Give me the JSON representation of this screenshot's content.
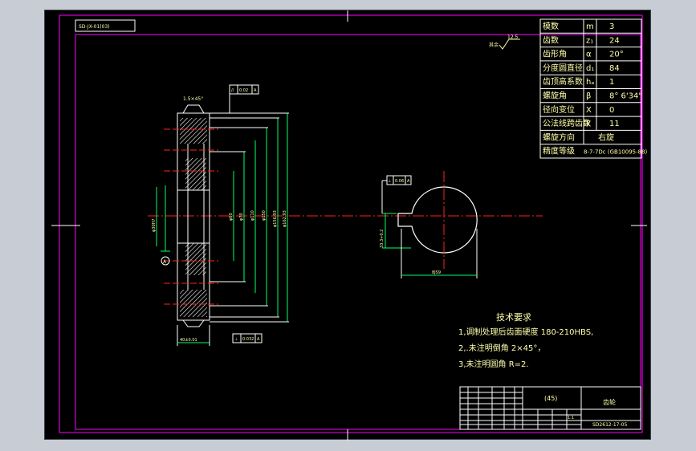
{
  "colors": {
    "background": "#000000",
    "frame": "#ff00ff",
    "line": "#ffffff",
    "text": "#ffffaa",
    "dimension": "#00ff66",
    "center": "#ff2020",
    "hatch": "#ffffff"
  },
  "drawing_code_box": "SD-JX-01(03)",
  "surface_finish": {
    "label": "其余",
    "value": "12.5"
  },
  "params_table": [
    {
      "name": "模数",
      "symbol": "m",
      "value": "3"
    },
    {
      "name": "齿数",
      "symbol": "z₁",
      "value": "24"
    },
    {
      "name": "齿形角",
      "symbol": "α",
      "value": "20°"
    },
    {
      "name": "分度圆直径",
      "symbol": "d₁",
      "value": "84"
    },
    {
      "name": "齿顶高系数",
      "symbol": "hₐ",
      "value": "1"
    },
    {
      "name": "螺旋角",
      "symbol": "β",
      "value": "8° 6'34\""
    },
    {
      "name": "径向变位",
      "symbol": "X",
      "value": "0"
    },
    {
      "name": "公法线跨齿数",
      "symbol": "k",
      "value": "11"
    },
    {
      "name": "螺旋方向",
      "symbol": "",
      "value": "右旋"
    },
    {
      "name": "精度等级",
      "symbol": "",
      "value": "8-7-7Dc (GB10095-88)"
    }
  ],
  "side_view": {
    "chamfer_label": "1.5×45°",
    "tolerance_top": [
      "//",
      "0.02",
      "A"
    ],
    "tolerance_bottom": [
      "⊥",
      "0.032",
      "A"
    ],
    "datum": "A",
    "dims": [
      "φ30H7",
      "φ60",
      "φ70",
      "φ110",
      "φ150",
      "φ156.93",
      "φ162.93"
    ],
    "width_dim": "40±0.01"
  },
  "front_view": {
    "tolerance": [
      "⊥",
      "0.06",
      "A"
    ],
    "keyway_height": "33.3+0.2",
    "keyway_width": "8JS9"
  },
  "tech_requirements": {
    "title": "技术要求",
    "items": [
      "1,调制处理后齿面硬度 180-210HBS,",
      "2,.未注明倒角 2×45°，",
      "3,未注明圆角 R=2."
    ]
  },
  "title_block": {
    "material": "(45)",
    "part_name": "齿轮",
    "drawing_number": "SD2612-17-05",
    "scale": "1:1"
  }
}
